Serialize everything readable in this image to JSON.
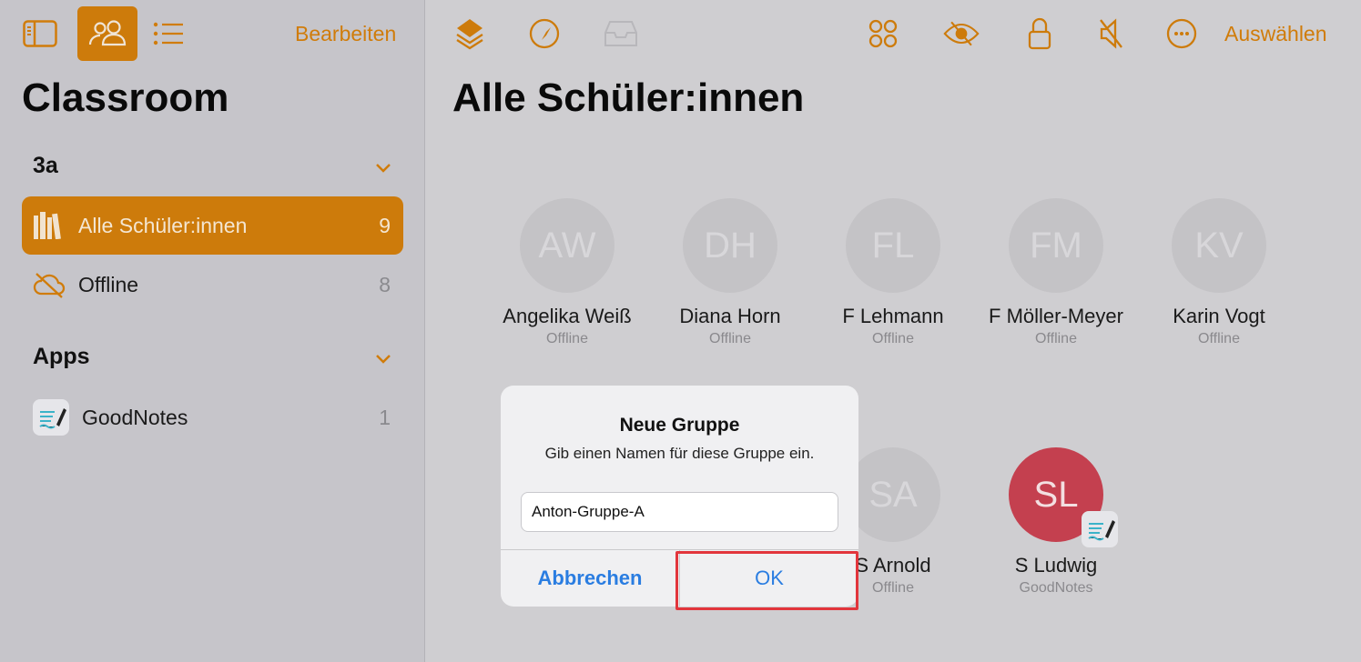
{
  "colors": {
    "accent": "#cd7b0b",
    "highlight": "#e2353c",
    "link": "#2a7de1",
    "avatar_active": "#c4404f"
  },
  "sidebar": {
    "toolbar": {
      "edit_label": "Bearbeiten",
      "icons": [
        "sidebar-icon",
        "people-icon",
        "list-icon"
      ]
    },
    "title": "Classroom",
    "sections": [
      {
        "title": "3a",
        "items": [
          {
            "label": "Alle Schüler:innen",
            "count": "9",
            "icon": "books-icon",
            "selected": true
          },
          {
            "label": "Offline",
            "count": "8",
            "icon": "cloud-offline-icon"
          }
        ]
      },
      {
        "title": "Apps",
        "items": [
          {
            "label": "GoodNotes",
            "count": "1",
            "icon": "goodnotes-icon"
          }
        ]
      }
    ]
  },
  "main": {
    "toolbar": {
      "icons": [
        "layers-icon",
        "compass-icon",
        "tray-icon",
        "apps-grid-icon",
        "eye-slash-icon",
        "lock-icon",
        "mute-icon",
        "more-icon"
      ],
      "select_label": "Auswählen"
    },
    "title": "Alle Schüler:innen",
    "students": [
      {
        "initials": "AW",
        "name": "Angelika Weiß",
        "status": "Offline"
      },
      {
        "initials": "DH",
        "name": "Diana Horn",
        "status": "Offline"
      },
      {
        "initials": "FL",
        "name": "F Lehmann",
        "status": "Offline"
      },
      {
        "initials": "FM",
        "name": "F Möller-Meyer",
        "status": "Offline"
      },
      {
        "initials": "KV",
        "name": "Karin Vogt",
        "status": "Offline"
      },
      {
        "initials": "SA",
        "name": "S Arnold",
        "status": "Offline"
      },
      {
        "initials": "SL",
        "name": "S Ludwig",
        "status": "GoodNotes"
      }
    ]
  },
  "dialog": {
    "title": "Neue Gruppe",
    "message": "Gib einen Namen für diese Gruppe ein.",
    "input_value": "Anton-Gruppe-A",
    "cancel_label": "Abbrechen",
    "ok_label": "OK"
  }
}
